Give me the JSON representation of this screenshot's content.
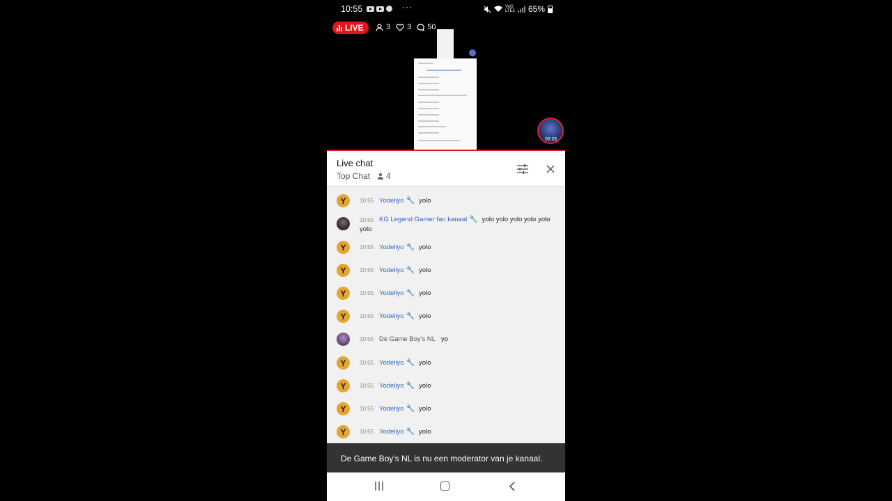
{
  "status_bar": {
    "time": "10:55",
    "dots": "···",
    "network": "VoG LTE2",
    "battery": "65%"
  },
  "stream": {
    "live_label": "LIVE",
    "viewers": "3",
    "likes": "3",
    "comments": "50",
    "floating_timer": "05:05"
  },
  "chat": {
    "title": "Live chat",
    "mode": "Top Chat",
    "viewer_count": "4",
    "messages": [
      {
        "time": "10:55",
        "author": "Yodeliyo",
        "moderator": true,
        "text": "yolo",
        "avatar": "Y"
      },
      {
        "time": "10:55",
        "author": "KG Legend Gamer fan kanaal",
        "moderator": true,
        "text": "yolo yolo yolo yolo yolo yolo",
        "avatar": ""
      },
      {
        "time": "10:55",
        "author": "Yodeliyo",
        "moderator": true,
        "text": "yolo",
        "avatar": "Y"
      },
      {
        "time": "10:55",
        "author": "Yodeliyo",
        "moderator": true,
        "text": "yolo",
        "avatar": "Y"
      },
      {
        "time": "10:55",
        "author": "Yodeliyo",
        "moderator": true,
        "text": "yolo",
        "avatar": "Y"
      },
      {
        "time": "10:55",
        "author": "Yodeliyo",
        "moderator": true,
        "text": "yolo",
        "avatar": "Y"
      },
      {
        "time": "10:55",
        "author": "De Game Boy's NL",
        "moderator": false,
        "text": "yo",
        "avatar": ""
      },
      {
        "time": "10:55",
        "author": "Yodeliyo",
        "moderator": true,
        "text": "yolo",
        "avatar": "Y"
      },
      {
        "time": "10:55",
        "author": "Yodeliyo",
        "moderator": true,
        "text": "yolo",
        "avatar": "Y"
      },
      {
        "time": "10:55",
        "author": "Yodeliyo",
        "moderator": true,
        "text": "yolo",
        "avatar": "Y"
      },
      {
        "time": "10:55",
        "author": "Yodeliyo",
        "moderator": true,
        "text": "yolo",
        "avatar": "Y"
      }
    ]
  },
  "snackbar": {
    "text": "De Game Boy's NL is nu een moderator van je kanaal."
  },
  "colors": {
    "live_red": "#e5161b",
    "author_blue": "#2d67c6",
    "avatar_gold": "#e4a534",
    "snackbar_bg": "#333333"
  }
}
